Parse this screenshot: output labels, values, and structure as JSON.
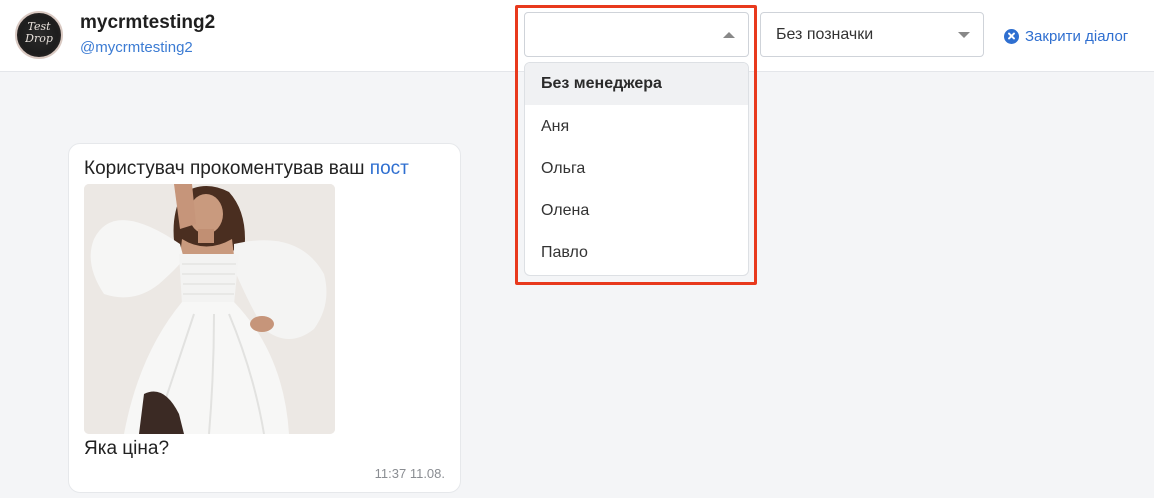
{
  "header": {
    "avatar_text_line1": "Test",
    "avatar_text_line2": "Drop",
    "user_name": "mycrmtesting2",
    "user_handle": "@mycrmtesting2",
    "manager_select": {
      "value": ""
    },
    "tag_select": {
      "value": "Без позначки"
    },
    "close_dialog_label": "Закрити діалог"
  },
  "manager_dropdown": {
    "items": [
      {
        "label": "Без менеджера",
        "active": true
      },
      {
        "label": "Аня",
        "active": false
      },
      {
        "label": "Ольга",
        "active": false
      },
      {
        "label": "Олена",
        "active": false
      },
      {
        "label": "Павло",
        "active": false
      }
    ]
  },
  "message": {
    "intro_text": "Користувач прокоментував ваш ",
    "link_text": "пост",
    "text": "Яка ціна?",
    "time": "11:37 11.08."
  },
  "colors": {
    "accent": "#2f6fd0",
    "highlight": "#e8391d",
    "background": "#f4f5f7"
  }
}
